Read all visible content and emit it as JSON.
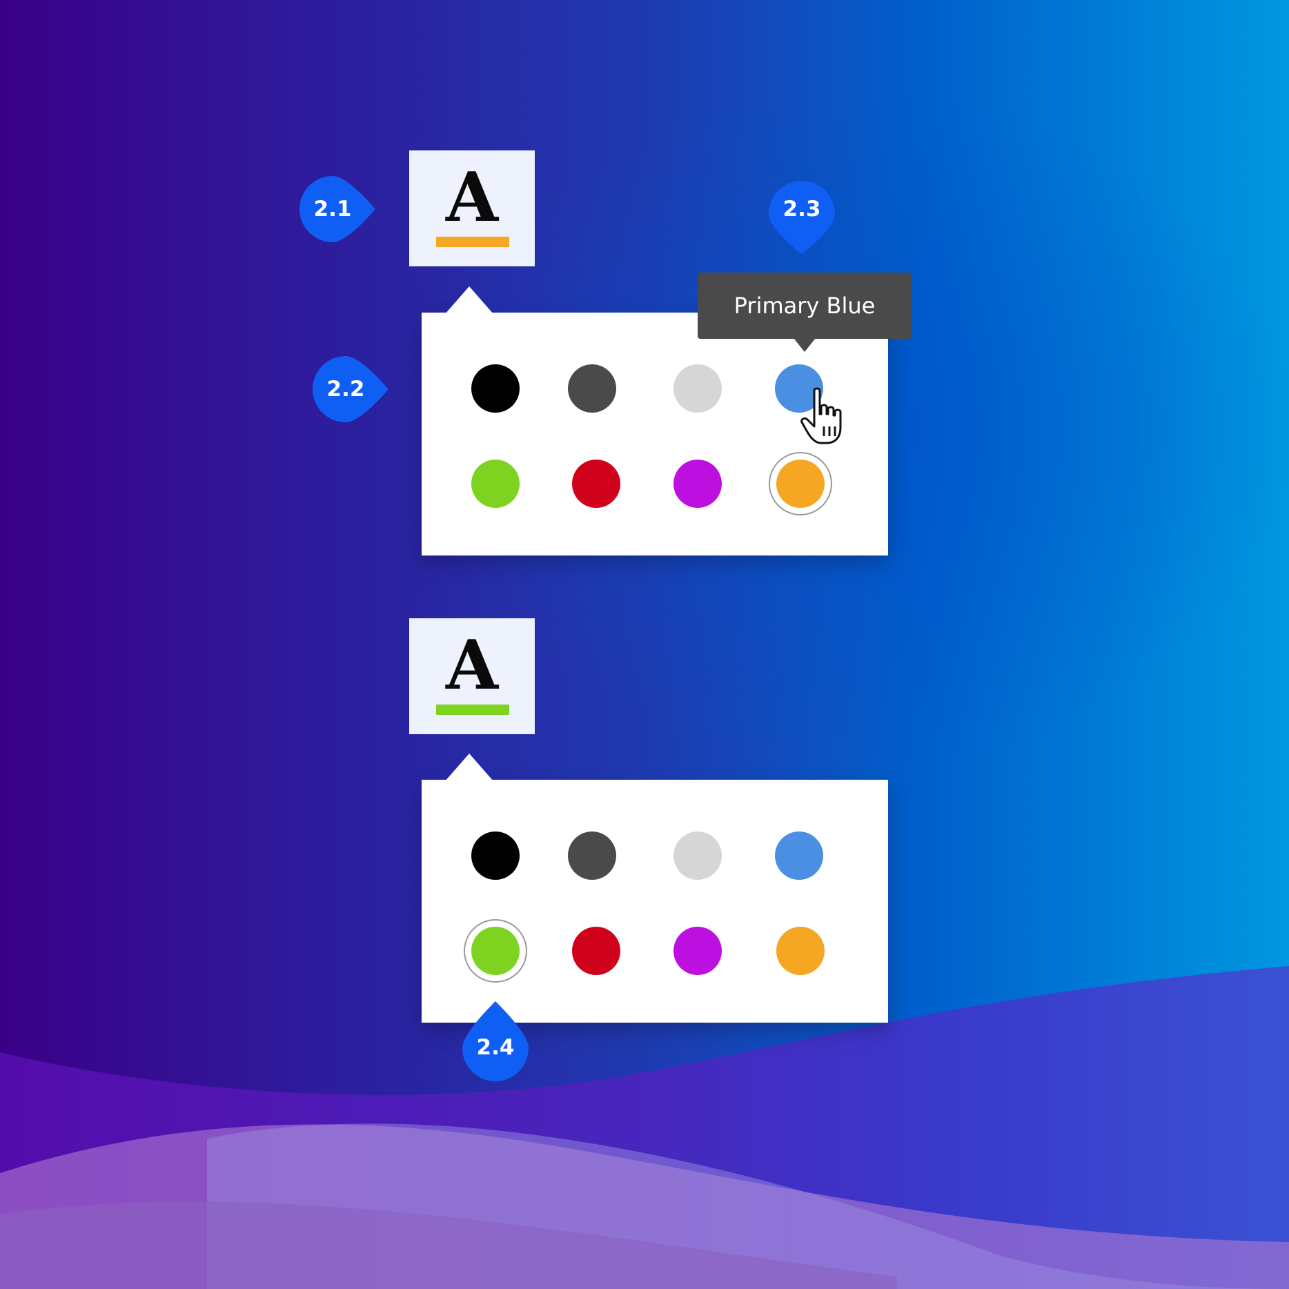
{
  "font_color_button": {
    "glyph": "A"
  },
  "tooltip": {
    "text": "Primary Blue"
  },
  "markers": [
    "2.1",
    "2.2",
    "2.3",
    "2.4"
  ],
  "swatch_colors": {
    "black": "#000000",
    "dark-gray": "#4a4a4a",
    "light-gray": "#d6d6d6",
    "primary-blue": "#4a8fe2",
    "green": "#7ed321",
    "red": "#d0021b",
    "purple": "#bd10e0",
    "orange": "#f5a623"
  },
  "picker_1": {
    "selected": "orange",
    "hovered": "primary-blue",
    "underline_color": "#f5a623"
  },
  "picker_2": {
    "selected": "green",
    "underline_color": "#7ed321"
  },
  "accent_color": "#0f5ff5",
  "icons": [
    "hand-pointer-icon",
    "caret-up-icon"
  ]
}
